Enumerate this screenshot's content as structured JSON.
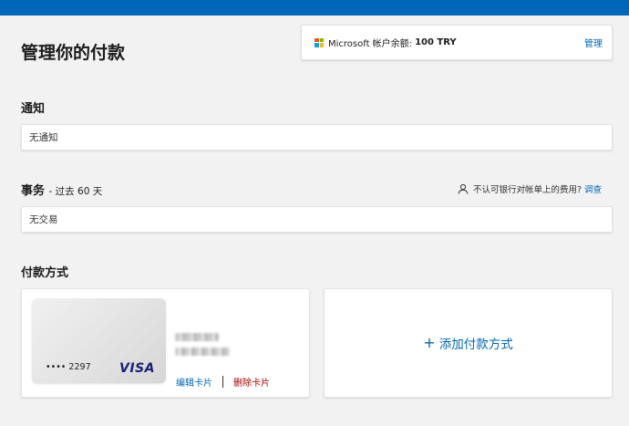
{
  "page": {
    "title": "管理你的付款"
  },
  "balance": {
    "label": "Microsoft 帐户余额:",
    "amount": "100 TRY",
    "manage_label": "管理"
  },
  "notifications": {
    "title": "通知",
    "empty_text": "无通知"
  },
  "transactions": {
    "title": "事务",
    "subtitle": "- 过去 60 天",
    "dispute_text": "不认可银行对帐单上的费用?",
    "dispute_link": "调查",
    "empty_text": "无交易"
  },
  "payment_methods": {
    "title": "付款方式",
    "card": {
      "masked_number": "•••• 2297",
      "brand": "VISA",
      "edit_label": "编辑卡片",
      "delete_label": "删除卡片"
    },
    "add_label": "添加付款方式"
  },
  "colors": {
    "accent": "#0067b8",
    "danger": "#a80000",
    "background": "#f2f2f2"
  },
  "icons": [
    "microsoft-logo-icon",
    "person-icon",
    "plus-icon",
    "visa-logo"
  ]
}
